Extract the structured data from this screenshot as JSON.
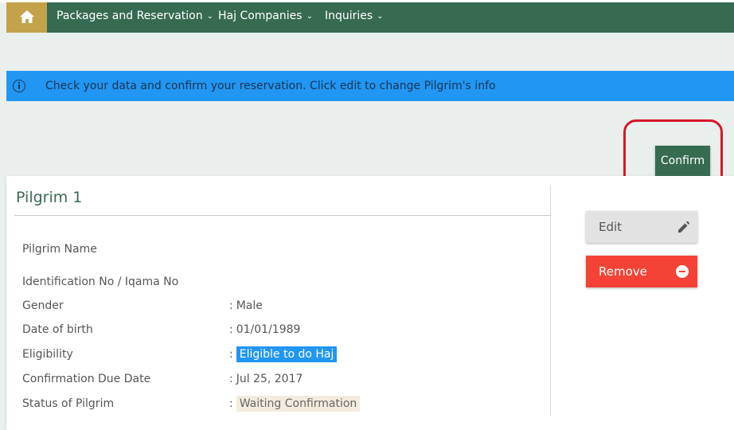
{
  "nav": {
    "items": [
      {
        "label": "Packages and Reservation"
      },
      {
        "label": "Haj Companies"
      },
      {
        "label": "Inquiries"
      }
    ]
  },
  "alert": {
    "message": "Check your data and confirm your reservation. Click edit to change Pilgrim's info"
  },
  "actions": {
    "confirm_label": "Confirm"
  },
  "pilgrim": {
    "title": "Pilgrim 1",
    "edit_label": "Edit",
    "remove_label": "Remove",
    "fields": [
      {
        "label": "Pilgrim Name",
        "value": ""
      },
      {
        "label": "Identification No / Iqama No",
        "value": ""
      },
      {
        "label": "Gender",
        "value": "Male"
      },
      {
        "label": "Date of birth",
        "value": "01/01/1989"
      },
      {
        "label": "Eligibility",
        "value": "Eligible to do Haj"
      },
      {
        "label": "Confirmation Due Date",
        "value": "Jul 25, 2017"
      },
      {
        "label": "Status of Pilgrim",
        "value": "Waiting Confirmation"
      }
    ]
  },
  "colors": {
    "navbar": "#366b52",
    "home_button": "#c4a24a",
    "alert": "#2196f3",
    "remove": "#f44336",
    "highlight_ring": "#d9142b"
  },
  "icons": [
    "home-icon",
    "chevron-down-icon",
    "info-icon",
    "pencil-icon",
    "minus-circle-icon"
  ]
}
